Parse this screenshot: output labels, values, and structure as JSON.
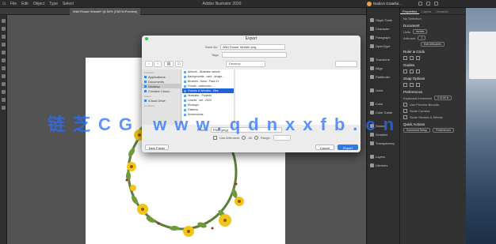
{
  "app": {
    "title": "Adobe Illustrator 2020",
    "menu": [
      "File",
      "Edit",
      "Object",
      "Type",
      "Select",
      "Effect",
      "View",
      "Window",
      "Help"
    ],
    "user": "Nadia's Grateful..."
  },
  "tabs": [
    {
      "label": "Wild Flower Wreath* @ 50% (CMYK/Preview)"
    }
  ],
  "right_nav": [
    {
      "label": "Glyph Tools",
      "icon": "glyph-icon"
    },
    {
      "label": "Character",
      "icon": "character-icon"
    },
    {
      "label": "Paragraph",
      "icon": "paragraph-icon"
    },
    {
      "label": "OpenType",
      "icon": "opentype-icon"
    },
    {
      "label": "Transform",
      "icon": "transform-icon"
    },
    {
      "label": "Align",
      "icon": "align-icon"
    },
    {
      "label": "Pathfinder",
      "icon": "pathfinder-icon"
    },
    {
      "label": "Links",
      "icon": "links-icon"
    },
    {
      "label": "Color",
      "icon": "color-icon"
    },
    {
      "label": "Color Guide",
      "icon": "color-guide-icon"
    },
    {
      "label": "Stroke",
      "icon": "stroke-icon"
    },
    {
      "label": "Gradient",
      "icon": "gradient-icon"
    },
    {
      "label": "Transparency",
      "icon": "transparency-icon"
    },
    {
      "label": "Layers",
      "icon": "layers-icon"
    },
    {
      "label": "Libraries",
      "icon": "libraries-icon"
    }
  ],
  "properties": {
    "tabs": [
      "Properties",
      "Layers",
      "Libraries"
    ],
    "active_tab": "Properties",
    "section1": "No Selection",
    "doc_label": "Document",
    "units_label": "Units",
    "units_value": "Inches",
    "artboard_label": "Artboard",
    "artboard_value": "1",
    "edit_artboards": "Edit Artboards",
    "ruler_grids": "Ruler & Grids",
    "guides": "Guides",
    "snap_options": "Snap Options",
    "preferences": "Preferences",
    "keyboard_increment": "Keyboard Increment",
    "keyboard_value": "0.0139 in",
    "use_preview_bounds": "Use Preview Bounds",
    "scale_corners": "Scale Corners",
    "scale_strokes": "Scale Strokes & Effects",
    "quick_actions": "Quick Actions",
    "document_setup": "Document Setup",
    "preferences_btn": "Preferences"
  },
  "dialog": {
    "title": "Export",
    "save_as_label": "Save As:",
    "save_as_value": "Wild Flower Wreath.png",
    "tags_label": "Tags:",
    "location": "Desktop",
    "sidebar": {
      "favorites_header": "Favorites",
      "favorites": [
        "Applications",
        "Documents",
        "Desktop",
        "Creative Cloud..."
      ],
      "icloud_header": "iCloud",
      "icloud": [
        "iCloud Drive"
      ],
      "locations_header": "Locations"
    },
    "files": [
      "Artwork - Illustrator assets",
      "Backgrounds - card - Image...",
      "Brushes - floral - Pack 01",
      "Florals - watercolor - ...",
      "Frames & Wreaths - files",
      "Illustrator - Projects",
      "Leaves - set - 2020",
      "Mockups",
      "Patterns",
      "Screenshots"
    ],
    "selected_file_index": 4,
    "format_label": "Format:",
    "format_value": "PNG (png)",
    "use_artboards_label": "Use Artboards",
    "use_artboards_all": "All",
    "range_label": "Range:",
    "new_folder": "New Folder",
    "cancel": "Cancel",
    "export": "Export"
  },
  "watermark": "链芝CG www.qdnxxfb.cn",
  "colors": {
    "accent": "#2f7ae5",
    "panel_bg": "#323232",
    "canvas_bg": "#535353",
    "watermark": "#286eff"
  }
}
